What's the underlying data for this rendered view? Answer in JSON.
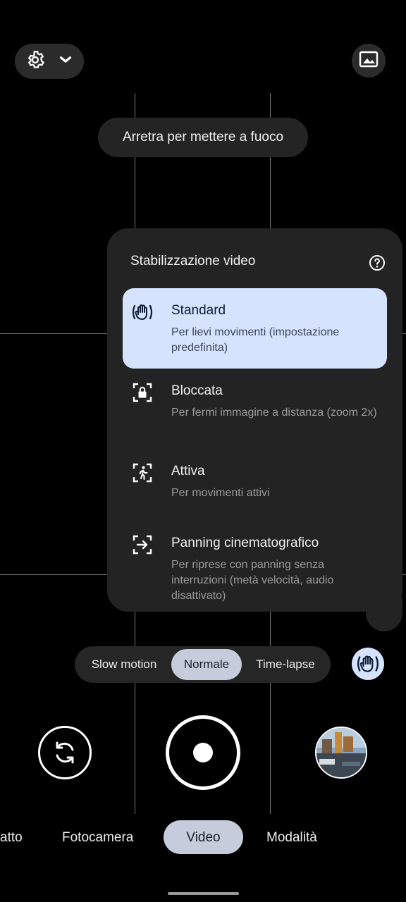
{
  "toast": "Arretra per mettere a fuoco",
  "panel": {
    "title": "Stabilizzazione video",
    "options": [
      {
        "title": "Standard",
        "subtitle": "Per lievi movimenti (impostazione predefinita)",
        "selected": true
      },
      {
        "title": "Bloccata",
        "subtitle": "Per fermi immagine a distanza (zoom 2x)",
        "selected": false
      },
      {
        "title": "Attiva",
        "subtitle": "Per movimenti attivi",
        "selected": false
      },
      {
        "title": "Panning cinematografico",
        "subtitle": "Per riprese con panning senza interruzioni (metà velocità, audio disattivato)",
        "selected": false
      }
    ]
  },
  "speed": {
    "items": [
      "Slow motion",
      "Normale",
      "Time-lapse"
    ],
    "selected": "Normale"
  },
  "modes": {
    "items": [
      "atto",
      "Fotocamera",
      "Video",
      "Modalità"
    ],
    "selected": "Video"
  },
  "colors": {
    "selected_option_bg": "#d6e3ff",
    "chip_selected_bg": "#c6ccdc",
    "panel_bg": "#232323"
  },
  "icons": {
    "settings": "gear-icon",
    "dropdown": "chevron-down-icon",
    "gallery": "gallery-icon",
    "help": "help-circle-icon",
    "flip_camera": "flip-camera-icon"
  }
}
